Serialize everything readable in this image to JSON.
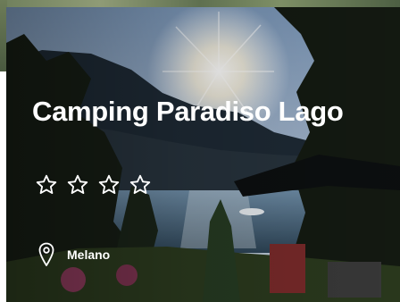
{
  "card": {
    "title": "Camping Paradiso Lago",
    "rating": {
      "stars_total": 4,
      "stars_filled": 0,
      "icon": "star-outline-icon"
    },
    "location": {
      "icon": "map-pin-icon",
      "label": "Melano"
    }
  },
  "colors": {
    "text": "#ffffff"
  }
}
